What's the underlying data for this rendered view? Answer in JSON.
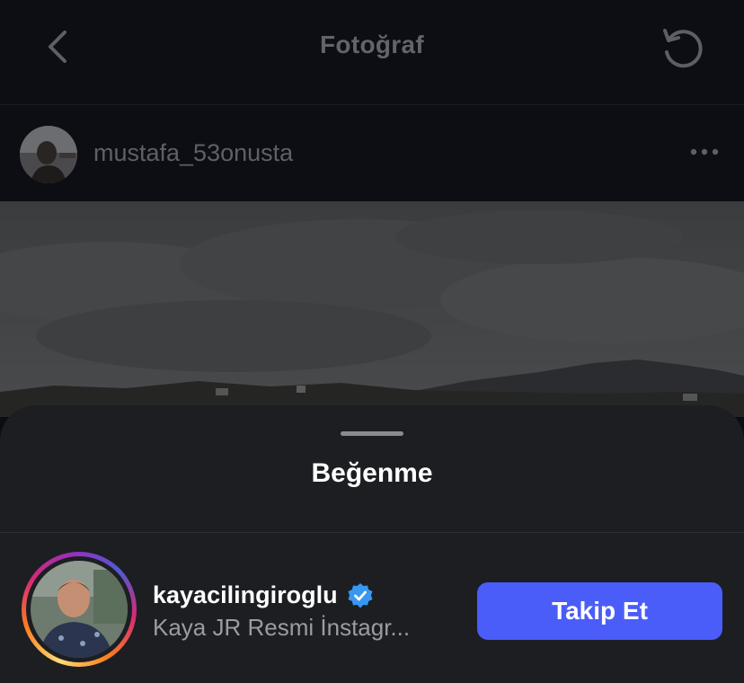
{
  "header": {
    "title": "Fotoğraf",
    "back_icon": "chevron-left-icon",
    "refresh_icon": "refresh-icon"
  },
  "post": {
    "username": "mustafa_53onusta",
    "more_icon": "more-horizontal-icon"
  },
  "sheet": {
    "title": "Beğenme",
    "users": [
      {
        "username": "kayacilingiroglu",
        "verified": true,
        "subtitle": "Kaya JR Resmi İnstagr...",
        "follow_label": "Takip Et"
      }
    ]
  },
  "colors": {
    "follow_button": "#4a5df9",
    "verified_badge": "#3897f0",
    "sheet_background": "#1c1e22",
    "header_background": "#0c0e13"
  }
}
